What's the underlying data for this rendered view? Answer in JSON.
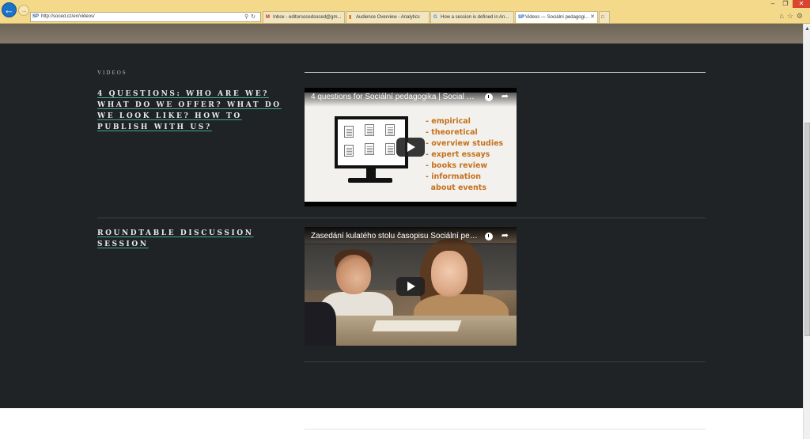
{
  "browser": {
    "address_url": "http://soced.cz/en/videos/",
    "tabs": [
      {
        "icon": "gmail-icon",
        "label": "Inbox - editorsocedsoced@gm..."
      },
      {
        "icon": "analytics-icon",
        "label": "Audience Overview - Analytics"
      },
      {
        "icon": "google-icon",
        "label": "How a session is defined in An..."
      },
      {
        "icon": "soced-icon",
        "label": "Videos — Sociální pedagogi...",
        "active": true
      }
    ],
    "accent_color": "#f5d98a"
  },
  "page": {
    "section_title": "VIDEOS",
    "videos": [
      {
        "link_text": "4 QUESTIONS: WHO ARE WE? WHAT DO WE OFFER? WHAT DO WE LOOK LIKE? HOW TO PUBLISH WITH US?",
        "player_title": "4 questions for Sociální pedagogika | Social Edu...",
        "bullets": [
          "- empirical",
          "- theoretical",
          "- overview studies",
          "- expert essays",
          "- books review",
          "- information",
          "  about events"
        ]
      },
      {
        "link_text": "ROUNDTABLE DISCUSSION SESSION",
        "player_title": "Zasedání kulatého stolu časopisu Sociální peda..."
      }
    ],
    "colors": {
      "background": "#1f2326",
      "link_underline": "#3fa98a",
      "bullet_text": "#c6711c"
    }
  }
}
